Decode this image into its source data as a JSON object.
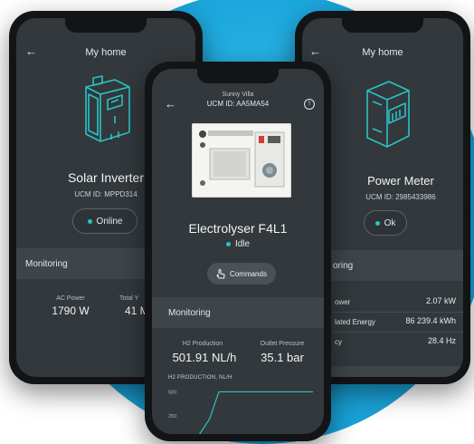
{
  "left": {
    "header": "My home",
    "device_name": "Solar Inverter",
    "device_id": "UCM ID: MPPD314",
    "status": "Online",
    "monitoring": "Monitoring",
    "metrics": [
      {
        "label": "AC Power",
        "value": "1790 W"
      },
      {
        "label": "Total Y",
        "value": "41 M"
      }
    ]
  },
  "right": {
    "header": "My home",
    "device_name": "Power Meter",
    "device_id": "UCM ID: 2985433986",
    "status": "Ok",
    "monitoring": "oring",
    "rows": [
      {
        "label": "ower",
        "value": "2.07 kW"
      },
      {
        "label": "lated Energy",
        "value": "86 239.4 kWh"
      },
      {
        "label": "cy",
        "value": "28.4 Hz"
      }
    ]
  },
  "center": {
    "site": "Sunny Villa",
    "ucm_id": "UCM ID: AA5MA54",
    "device_name": "Electrolyser F4L1",
    "status": "Idle",
    "commands_label": "Commands",
    "monitoring": "Monitoring",
    "metrics": [
      {
        "label": "H2 Production",
        "value": "501.91 NL/h"
      },
      {
        "label": "Outlet Pressure",
        "value": "35.1 bar"
      }
    ],
    "chart_title": "H2 PRODUCTION, NL/H"
  },
  "chart_data": {
    "type": "line",
    "title": "H2 PRODUCTION, NL/H",
    "yticks": [
      500,
      250
    ],
    "ylim": [
      0,
      560
    ],
    "xlim": [
      0,
      10
    ],
    "series": [
      {
        "x": [
          0,
          1.2,
          2.0,
          10
        ],
        "y": [
          0,
          220,
          500,
          500
        ]
      }
    ]
  },
  "colors": {
    "accent": "#29c3c6",
    "screen_bg": "#32383c",
    "band_bg": "#3d4549",
    "backdrop": "#1aa6dc"
  },
  "icons": [
    "back-arrow-icon",
    "info-icon",
    "inverter-icon",
    "meter-icon",
    "hand-pointer-icon"
  ]
}
